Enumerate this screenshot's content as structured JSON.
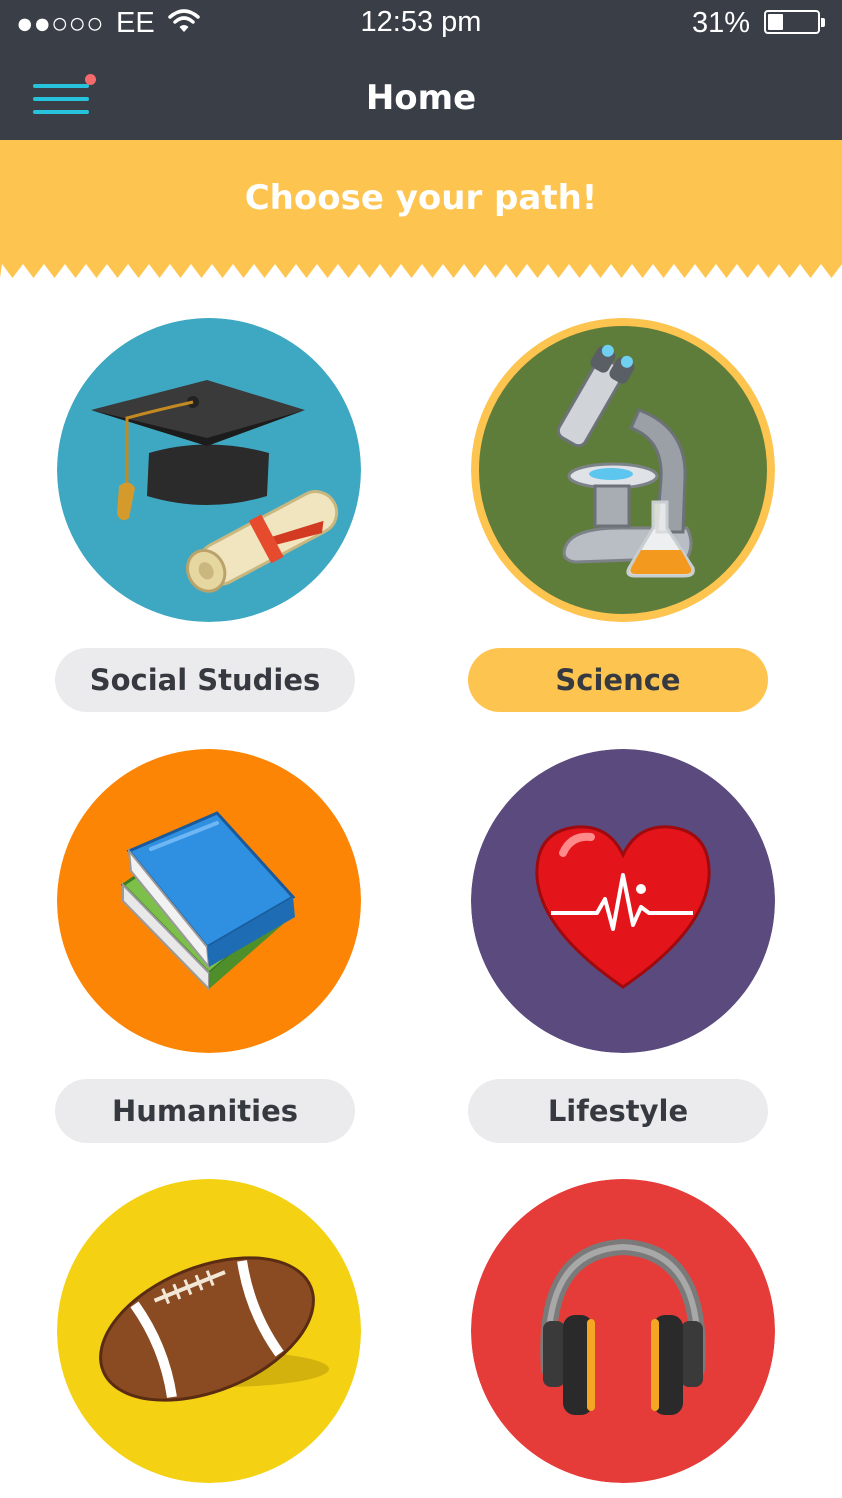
{
  "status_bar": {
    "signal": "●●○○○",
    "carrier": "EE",
    "time": "12:53 pm",
    "battery_percent": "31%",
    "battery_level": 0.31
  },
  "header": {
    "title": "Home"
  },
  "banner": {
    "text": "Choose your path!"
  },
  "categories": [
    {
      "label": "Social Studies",
      "icon": "graduation-cap-icon",
      "color": "#3ea8c3",
      "selected": false
    },
    {
      "label": "Science",
      "icon": "microscope-icon",
      "color": "#5f7d3a",
      "selected": true
    },
    {
      "label": "Humanities",
      "icon": "books-icon",
      "color": "#fd8505",
      "selected": false
    },
    {
      "label": "Lifestyle",
      "icon": "heart-icon",
      "color": "#5b4a7d",
      "selected": false
    },
    {
      "label": "",
      "icon": "football-icon",
      "color": "#f5d114",
      "selected": false
    },
    {
      "label": "",
      "icon": "headphones-icon",
      "color": "#e63c39",
      "selected": false
    }
  ],
  "colors": {
    "topbar": "#3a3f47",
    "accent": "#27c3dc",
    "banner": "#fdc450",
    "selected_ring": "#fdc450"
  }
}
